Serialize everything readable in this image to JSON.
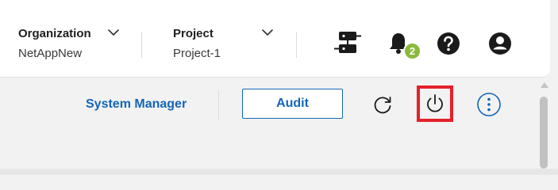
{
  "header": {
    "organization": {
      "label": "Organization",
      "value": "NetAppNew",
      "chevron_icon": "chevron-down-icon"
    },
    "project": {
      "label": "Project",
      "value": "Project-1",
      "chevron_icon": "chevron-down-icon"
    },
    "icons": {
      "workloads": "server-connector-icon",
      "notifications": "bell-icon",
      "help": "help-icon",
      "user": "user-icon"
    },
    "notification_count": "2"
  },
  "toolbar": {
    "system_manager_label": "System Manager",
    "audit_label": "Audit",
    "refresh_icon": "refresh-icon",
    "power_icon": "power-icon",
    "more_icon": "more-vertical-icon"
  },
  "colors": {
    "link_blue": "#1465b7",
    "badge_green": "#8bb93c",
    "highlight_red": "#e5202a",
    "background": "#f2f2f2",
    "header_bg": "#ffffff"
  }
}
